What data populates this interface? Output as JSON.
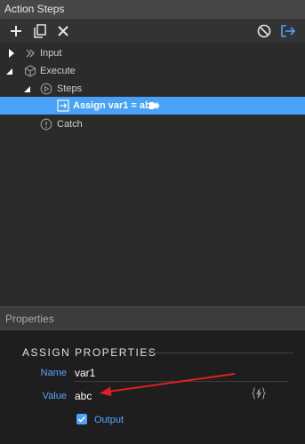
{
  "panel": {
    "title": "Action Steps"
  },
  "toolbar": {
    "add_icon": "plus-icon",
    "copy_icon": "copy-icon",
    "delete_icon": "x-icon",
    "disable_icon": "ban-icon",
    "export_icon": "export-icon"
  },
  "tree": {
    "input_label": "Input",
    "execute_label": "Execute",
    "steps_label": "Steps",
    "assign_label": "Assign var1 = abc",
    "catch_label": "Catch"
  },
  "properties": {
    "panel_title": "Properties",
    "section_title": "ASSIGN PROPERTIES",
    "name_label": "Name",
    "name_value": "var1",
    "value_label": "Value",
    "value_value": "abc",
    "output_label": "Output",
    "output_checked": true
  },
  "colors": {
    "selection": "#47a2f8",
    "accent": "#58a6ff",
    "annotation_arrow": "#e02020"
  }
}
